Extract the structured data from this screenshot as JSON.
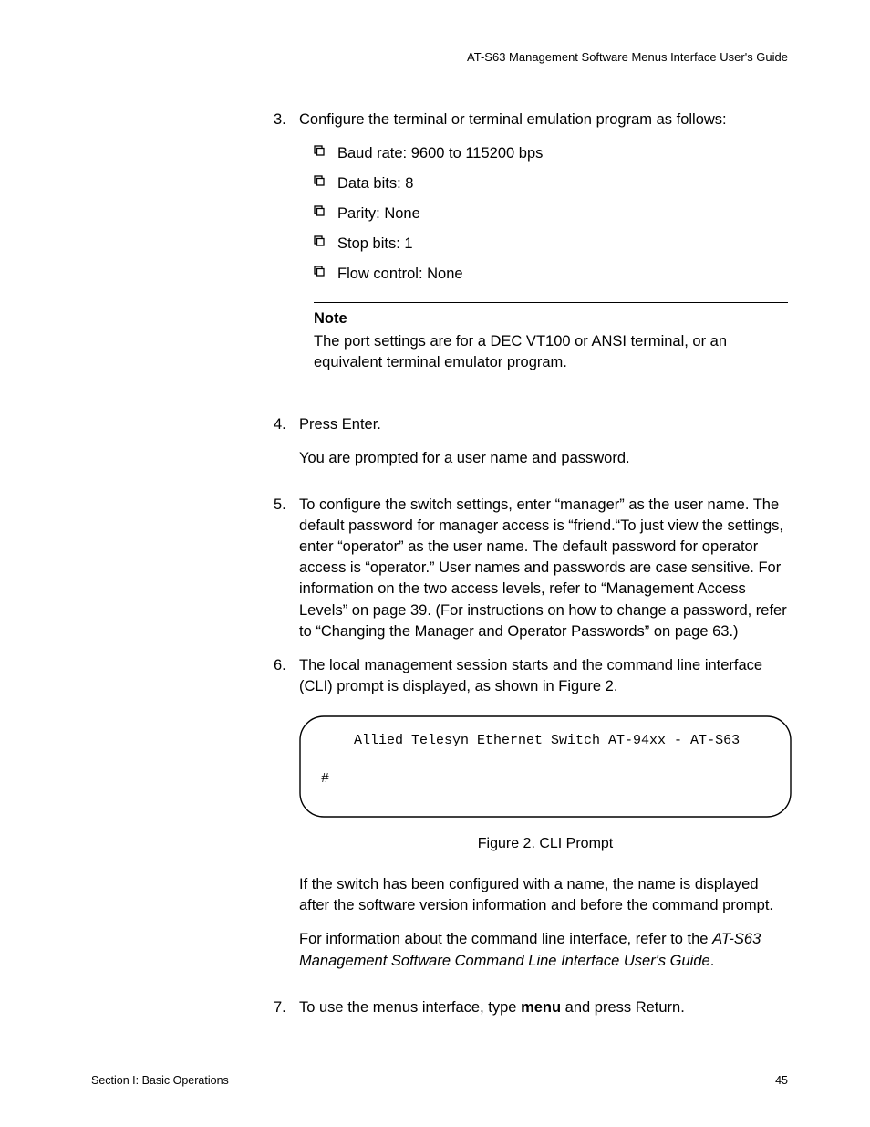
{
  "header": "AT-S63 Management Software Menus Interface User's Guide",
  "items": {
    "step3": {
      "num": "3.",
      "text": "Configure the terminal or terminal emulation program as follows:",
      "bullets": [
        "Baud rate: 9600 to 115200 bps",
        "Data bits: 8",
        "Parity: None",
        "Stop bits: 1",
        "Flow control: None"
      ],
      "note_title": "Note",
      "note_body": "The port settings are for a DEC VT100 or ANSI terminal, or an equivalent terminal emulator program."
    },
    "step4": {
      "num": "4.",
      "text": "Press Enter.",
      "para": "You are prompted for a user name and password."
    },
    "step5": {
      "num": "5.",
      "text": "To configure the switch settings, enter “manager” as the user name. The default password for manager access is “friend.“To just view the settings, enter “operator” as the user name. The default password for operator access is “operator.” User names and passwords are case sensitive. For information on the two access levels, refer to “Management Access Levels” on page 39. (For instructions on how to change a password, refer to “Changing the Manager and Operator Passwords” on page 63.)"
    },
    "step6": {
      "num": "6.",
      "text": "The local management session starts and the command line interface (CLI) prompt is displayed, as shown in Figure 2.",
      "cli_line1": "Allied Telesyn Ethernet Switch AT-94xx - AT-S63",
      "cli_prompt": "#",
      "caption": "Figure 2. CLI Prompt",
      "para1": "If the switch has been configured with a name, the name is displayed after the software version information and before the command prompt.",
      "para2a": "For information about the command line interface, refer to the ",
      "para2b": "AT-S63 Management Software Command Line Interface User's Guide",
      "para2c": "."
    },
    "step7": {
      "num": "7.",
      "text_a": "To use the menus interface, type ",
      "text_b": "menu",
      "text_c": " and press Return."
    }
  },
  "footer": {
    "left": "Section I: Basic Operations",
    "right": "45"
  }
}
